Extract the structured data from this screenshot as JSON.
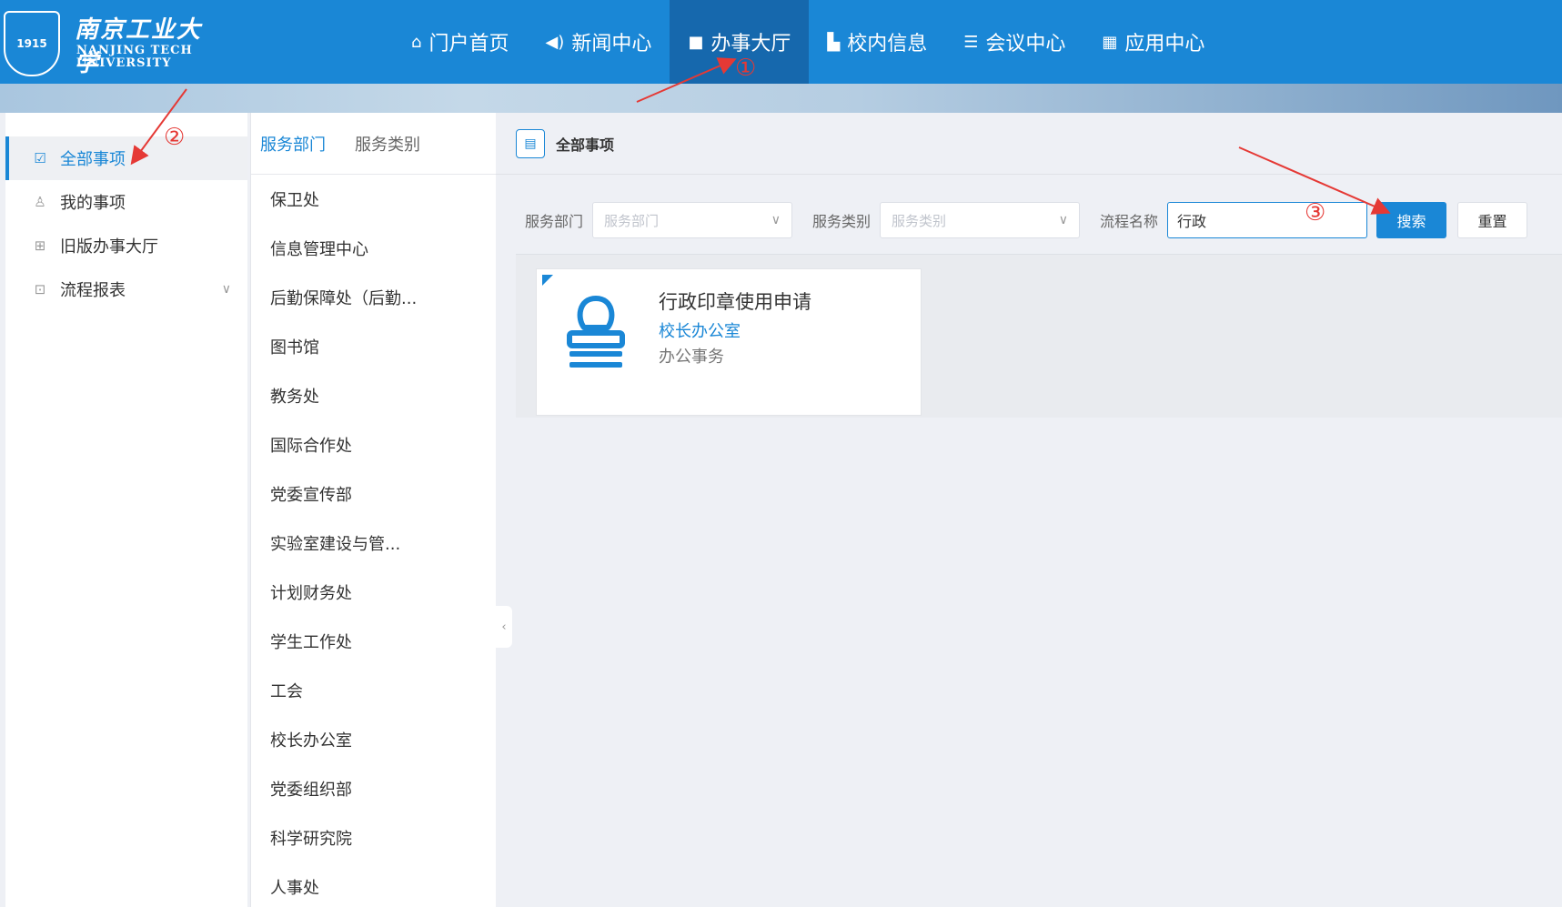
{
  "logo": {
    "crest_text": "1915",
    "name_cn": "南京工业大学",
    "name_en_line1": "NANJING TECH",
    "name_en_line2": "UNIVERSITY"
  },
  "nav": {
    "items": [
      {
        "label": "门户首页",
        "icon": "home-icon"
      },
      {
        "label": "新闻中心",
        "icon": "speaker-icon"
      },
      {
        "label": "办事大厅",
        "icon": "bag-icon",
        "active": true
      },
      {
        "label": "校内信息",
        "icon": "building-icon"
      },
      {
        "label": "会议中心",
        "icon": "list-icon"
      },
      {
        "label": "应用中心",
        "icon": "grid-icon"
      }
    ]
  },
  "sidebar": {
    "items": [
      {
        "label": "全部事项",
        "icon": "checkbox-icon",
        "active": true
      },
      {
        "label": "我的事项",
        "icon": "user-icon"
      },
      {
        "label": "旧版办事大厅",
        "icon": "apps-icon"
      },
      {
        "label": "流程报表",
        "icon": "report-icon",
        "has_children": true
      }
    ]
  },
  "dept_panel": {
    "tabs": [
      "服务部门",
      "服务类别"
    ],
    "active_tab": "服务部门",
    "departments": [
      "保卫处",
      "信息管理中心",
      "后勤保障处（后勤...",
      "图书馆",
      "教务处",
      "国际合作处",
      "党委宣传部",
      "实验室建设与管...",
      "计划财务处",
      "学生工作处",
      "工会",
      "校长办公室",
      "党委组织部",
      "科学研究院",
      "人事处"
    ]
  },
  "main": {
    "title": "全部事项",
    "filters": {
      "dept_label": "服务部门",
      "dept_placeholder": "服务部门",
      "category_label": "服务类别",
      "category_placeholder": "服务类别",
      "process_label": "流程名称",
      "process_value": "行政"
    },
    "search_button": "搜索",
    "reset_button": "重置",
    "results": [
      {
        "title": "行政印章使用申请",
        "department": "校长办公室",
        "category": "办公事务",
        "icon": "stamp-icon"
      }
    ]
  },
  "annotations": {
    "markers": [
      "①",
      "②",
      "③"
    ],
    "color": "#e53935"
  },
  "colors": {
    "primary": "#1a87d6",
    "header_active": "#1668ad"
  }
}
